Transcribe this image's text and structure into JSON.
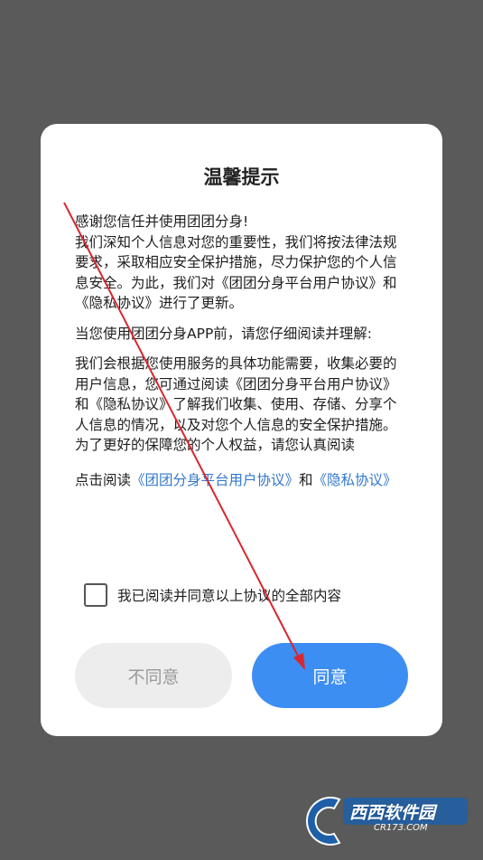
{
  "dialog": {
    "title": "温馨提示",
    "paragraph1": [
      "感谢您信任并使用团团分身!",
      "我们深知个人信息对您的重要性，我们将按法律法规要求，采取相应安全保护措施，尽力保护您的个人信息安全。为此，我们对《团团分身平台用户协议》和《隐私协议》进行了更新。"
    ],
    "paragraph2": "当您使用团团分身APP前，请您仔细阅读并理解:",
    "paragraph3": "我们会根据您使用服务的具体功能需要，收集必要的用户信息，您可通过阅读《团团分身平台用户协议》和《隐私协议》了解我们收集、使用、存储、分享个人信息的情况，以及对您个人信息的安全保护措施。",
    "paragraph4": "为了更好的保障您的个人权益，请您认真阅读",
    "read_prefix": "点击阅读",
    "user_agreement_link": "《团团分身平台用户协议》",
    "read_conjunction": "和",
    "privacy_link": "《隐私协议》",
    "agree_checkbox_label": "我已阅读并同意以上协议的全部内容",
    "agree_checked": false,
    "decline_button": "不同意",
    "accept_button": "同意"
  },
  "watermark": {
    "brand": "西西软件园",
    "domain": "CR173.COM"
  },
  "colors": {
    "backdrop": "#5a5a5a",
    "accent": "#3d8ef2",
    "link": "#3377cc",
    "annotation_arrow": "#d9262e"
  }
}
